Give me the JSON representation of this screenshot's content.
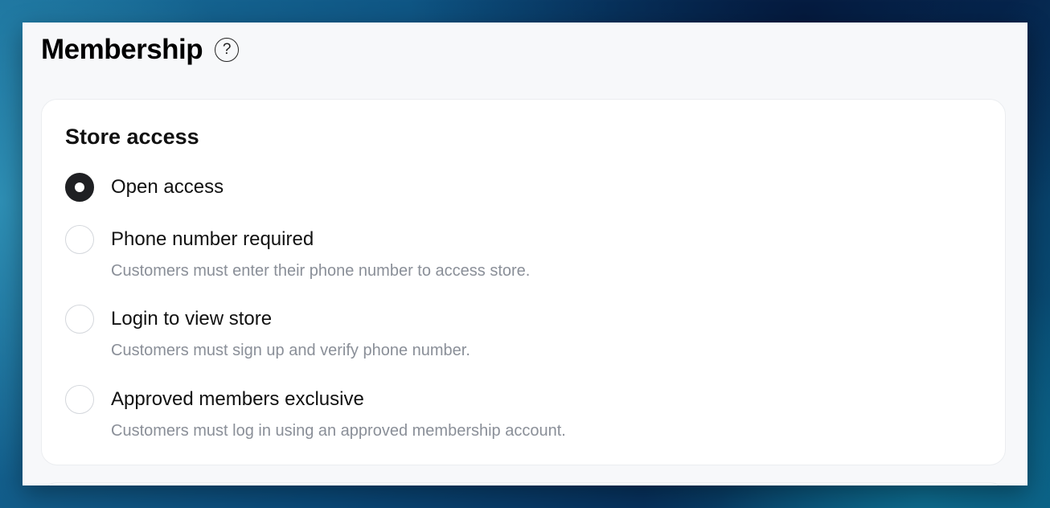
{
  "page": {
    "title": "Membership",
    "help_icon_glyph": "?"
  },
  "store_access": {
    "title": "Store access",
    "selected": "open_access",
    "options": [
      {
        "id": "open_access",
        "label": "Open access",
        "description": "",
        "checked": true
      },
      {
        "id": "phone_required",
        "label": "Phone number required",
        "description": "Customers must enter their phone number to access store.",
        "checked": false
      },
      {
        "id": "login_required",
        "label": "Login to view store",
        "description": "Customers must sign up and verify phone number.",
        "checked": false
      },
      {
        "id": "approved_members",
        "label": "Approved members exclusive",
        "description": "Customers must log in using an approved membership account.",
        "checked": false
      }
    ]
  },
  "icons": {
    "help": "question-circle-icon"
  },
  "colors": {
    "radio_checked": "#1f2023",
    "description_text": "#8a8f98",
    "page_bg": "#f7f8fa"
  }
}
